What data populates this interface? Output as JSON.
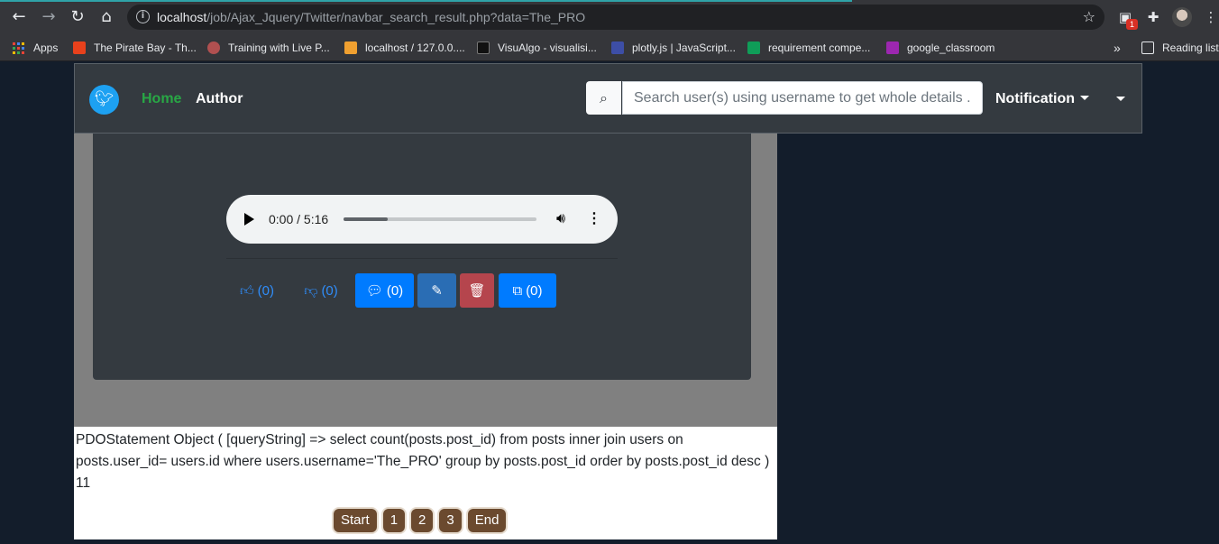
{
  "browser": {
    "url_host": "localhost",
    "url_path": "/job/Ajax_Jquery/Twitter/navbar_search_result.php?data=The_PRO",
    "extension_badge": "1",
    "bookmarks": [
      {
        "label": "Apps",
        "color": "#4285f4"
      },
      {
        "label": "The Pirate Bay - Th...",
        "color": "#e8411c"
      },
      {
        "label": "Training with Live P...",
        "color": "#b05050"
      },
      {
        "label": "localhost / 127.0.0....",
        "color": "#f0a030"
      },
      {
        "label": "VisuAlgo - visualisi...",
        "color": "#111111"
      },
      {
        "label": "plotly.js | JavaScript...",
        "color": "#3d4ea6"
      },
      {
        "label": "requirement compe...",
        "color": "#0f9d58"
      },
      {
        "label": "google_classroom",
        "color": "#9c27b0"
      }
    ],
    "overflow": "»",
    "reading_list": "Reading list"
  },
  "navbar": {
    "home": "Home",
    "author": "Author",
    "search_placeholder": "Search user(s) using username to get whole details ...",
    "notification": "Notification"
  },
  "player": {
    "time": "0:00 / 5:16",
    "progress": 0.23
  },
  "actions": {
    "like_count": "(0)",
    "dislike_count": "(0)",
    "comment_count": "(0)",
    "share_count": "(0)"
  },
  "debug": {
    "line1": "PDOStatement Object ( [queryString] => select count(posts.post_id) from posts inner join users on posts.user_id= users.id where users.username='The_PRO' group by posts.post_id order by posts.post_id desc )",
    "line2": "11"
  },
  "pagination": {
    "start": "Start",
    "pages": [
      "1",
      "2",
      "3"
    ],
    "end": "End"
  }
}
